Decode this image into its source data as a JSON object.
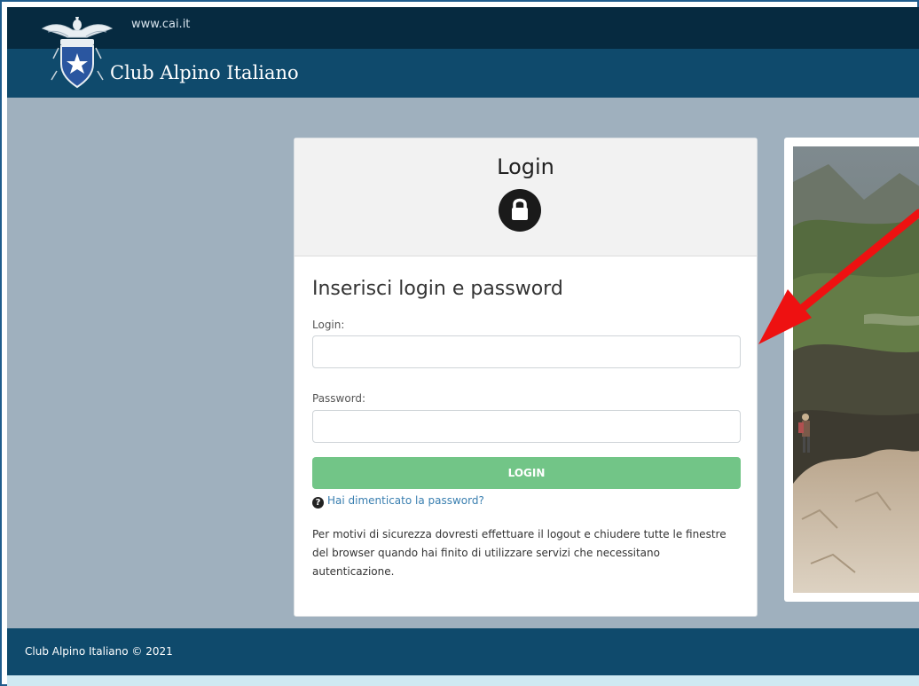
{
  "header": {
    "url_text": "www.cai.it",
    "brand_name": "Club Alpino Italiano"
  },
  "login": {
    "title": "Login",
    "subtitle": "Inserisci login e password",
    "login_label": "Login:",
    "login_value": "",
    "password_label": "Password:",
    "password_value": "",
    "submit_label": "LOGIN",
    "forgot_link": "Hai dimenticato la password?",
    "security_note": "Per motivi di sicurezza dovresti effettuare il logout e chiudere tutte le finestre del browser quando hai finito di utilizzare servizi che necessitano autenticazione."
  },
  "footer": {
    "copyright": "Club Alpino Italiano © 2021"
  },
  "icons": {
    "lock": "lock-icon",
    "question": "question-circle-icon",
    "logo": "cai-eagle-logo",
    "annotation": "red-arrow"
  },
  "colors": {
    "top_bar": "#062a40",
    "brand_bar": "#0f4a6c",
    "page_bg": "#9fb0be",
    "login_button": "#72c587",
    "link": "#3a7fb0",
    "annotation_arrow": "#ee1111"
  }
}
